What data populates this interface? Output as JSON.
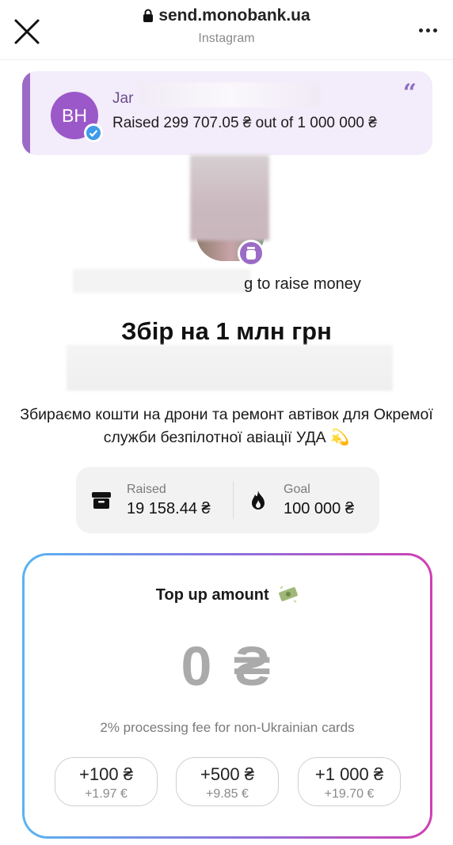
{
  "browser": {
    "url": "send.monobank.ua",
    "source_app": "Instagram"
  },
  "jar_card": {
    "avatar_initials": "ВН",
    "name_visible": "Jar",
    "raised_text": "Raised 299 707.05 ₴ out of 1 000 000 ₴"
  },
  "owner": {
    "line_suffix": "g to raise money"
  },
  "campaign": {
    "title": "Збір на 1 млн грн",
    "description": "Збираємо кошти на дрони та ремонт автівок для Окремої служби безпілотної авіації УДА 💫"
  },
  "stats": {
    "raised_label": "Raised",
    "raised_value": "19 158.44 ₴",
    "goal_label": "Goal",
    "goal_value": "100 000 ₴"
  },
  "topup": {
    "title": "Top up amount",
    "amount": "0 ₴",
    "fee_note": "2% processing fee for non-Ukrainian cards",
    "quick_amounts": [
      {
        "label": "+100 ₴",
        "sub": "+1.97 €"
      },
      {
        "label": "+500 ₴",
        "sub": "+9.85 €"
      },
      {
        "label": "+1 000 ₴",
        "sub": "+19.70 €"
      }
    ]
  },
  "colors": {
    "accent_purple": "#9b6bc6",
    "card_bg": "#f3ecfa",
    "gradient_start": "#5ab4f0",
    "gradient_end": "#d03fb2"
  },
  "icons": [
    "close-icon",
    "lock-icon",
    "more-icon",
    "verified-icon",
    "quote-icon",
    "jar-icon",
    "box-icon",
    "flame-icon",
    "money-icon"
  ]
}
